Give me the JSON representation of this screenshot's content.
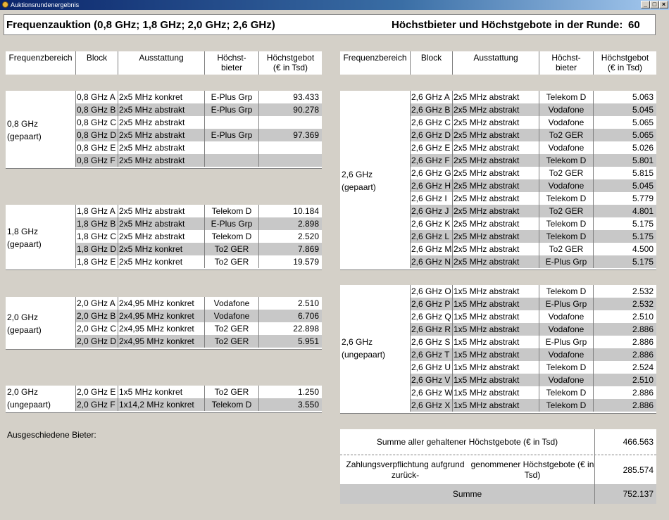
{
  "window": {
    "title": "Auktionsrundenergebnis",
    "buttons": {
      "minimize": "_",
      "restore": "□",
      "close": "×"
    }
  },
  "header": {
    "title": "Frequenzauktion (0,8 GHz; 1,8 GHz; 2,0 GHz; 2,6 GHz)",
    "round_label": "Höchstbieter und Höchstgebote in der Runde:",
    "round_number": "60"
  },
  "columns": {
    "range": "Frequenzbereich",
    "block": "Block",
    "ausstattung": "Ausstattung",
    "bidder_l1": "Höchst-",
    "bidder_l2": "bieter",
    "bid_l1": "Höchstgebot",
    "bid_l2": "(€ in Tsd)"
  },
  "groups": [
    {
      "range_l1": "0,8 GHz",
      "range_l2": "(gepaart)",
      "rows": [
        {
          "block": "0,8 GHz A",
          "ausstattung": "2x5 MHz konkret",
          "bidder": "E-Plus Grp",
          "bid": "93.433"
        },
        {
          "block": "0,8 GHz B",
          "ausstattung": "2x5 MHz abstrakt",
          "bidder": "E-Plus Grp",
          "bid": "90.278"
        },
        {
          "block": "0,8 GHz C",
          "ausstattung": "2x5 MHz abstrakt",
          "bidder": "",
          "bid": ""
        },
        {
          "block": "0,8 GHz D",
          "ausstattung": "2x5 MHz abstrakt",
          "bidder": "E-Plus Grp",
          "bid": "97.369"
        },
        {
          "block": "0,8 GHz E",
          "ausstattung": "2x5 MHz abstrakt",
          "bidder": "",
          "bid": ""
        },
        {
          "block": "0,8 GHz F",
          "ausstattung": "2x5 MHz abstrakt",
          "bidder": "",
          "bid": ""
        }
      ]
    },
    {
      "range_l1": "1,8 GHz",
      "range_l2": "(gepaart)",
      "rows": [
        {
          "block": "1,8 GHz A",
          "ausstattung": "2x5 MHz abstrakt",
          "bidder": "Telekom D",
          "bid": "10.184"
        },
        {
          "block": "1,8 GHz B",
          "ausstattung": "2x5 MHz abstrakt",
          "bidder": "E-Plus Grp",
          "bid": "2.898"
        },
        {
          "block": "1,8 GHz C",
          "ausstattung": "2x5 MHz abstrakt",
          "bidder": "Telekom D",
          "bid": "2.520"
        },
        {
          "block": "1,8 GHz D",
          "ausstattung": "2x5 MHz konkret",
          "bidder": "To2 GER",
          "bid": "7.869"
        },
        {
          "block": "1,8 GHz E",
          "ausstattung": "2x5 MHz konkret",
          "bidder": "To2 GER",
          "bid": "19.579"
        }
      ]
    },
    {
      "range_l1": "2,0 GHz",
      "range_l2": "(gepaart)",
      "rows": [
        {
          "block": "2,0 GHz A",
          "ausstattung": "2x4,95 MHz konkret",
          "bidder": "Vodafone",
          "bid": "2.510"
        },
        {
          "block": "2,0 GHz B",
          "ausstattung": "2x4,95 MHz konkret",
          "bidder": "Vodafone",
          "bid": "6.706"
        },
        {
          "block": "2,0 GHz C",
          "ausstattung": "2x4,95 MHz konkret",
          "bidder": "To2 GER",
          "bid": "22.898"
        },
        {
          "block": "2,0 GHz D",
          "ausstattung": "2x4,95 MHz konkret",
          "bidder": "To2 GER",
          "bid": "5.951"
        }
      ]
    },
    {
      "range_l1": "2,0 GHz",
      "range_l2": "(ungepaart)",
      "rows": [
        {
          "block": "2,0 GHz E",
          "ausstattung": "1x5 MHz konkret",
          "bidder": "To2 GER",
          "bid": "1.250"
        },
        {
          "block": "2,0 GHz F",
          "ausstattung": "1x14,2 MHz konkret",
          "bidder": "Telekom D",
          "bid": "3.550"
        }
      ]
    },
    {
      "range_l1": "2,6 GHz",
      "range_l2": "(gepaart)",
      "rows": [
        {
          "block": "2,6 GHz A",
          "ausstattung": "2x5 MHz abstrakt",
          "bidder": "Telekom D",
          "bid": "5.063"
        },
        {
          "block": "2,6 GHz B",
          "ausstattung": "2x5 MHz abstrakt",
          "bidder": "Vodafone",
          "bid": "5.045"
        },
        {
          "block": "2,6 GHz C",
          "ausstattung": "2x5 MHz abstrakt",
          "bidder": "Vodafone",
          "bid": "5.065"
        },
        {
          "block": "2,6 GHz D",
          "ausstattung": "2x5 MHz abstrakt",
          "bidder": "To2 GER",
          "bid": "5.065"
        },
        {
          "block": "2,6 GHz E",
          "ausstattung": "2x5 MHz abstrakt",
          "bidder": "Vodafone",
          "bid": "5.026"
        },
        {
          "block": "2,6 GHz F",
          "ausstattung": "2x5 MHz abstrakt",
          "bidder": "Telekom D",
          "bid": "5.801"
        },
        {
          "block": "2,6 GHz G",
          "ausstattung": "2x5 MHz abstrakt",
          "bidder": "To2 GER",
          "bid": "5.815"
        },
        {
          "block": "2,6 GHz H",
          "ausstattung": "2x5 MHz abstrakt",
          "bidder": "Vodafone",
          "bid": "5.045"
        },
        {
          "block": "2,6 GHz I",
          "ausstattung": "2x5 MHz abstrakt",
          "bidder": "Telekom D",
          "bid": "5.779"
        },
        {
          "block": "2,6 GHz J",
          "ausstattung": "2x5 MHz abstrakt",
          "bidder": "To2 GER",
          "bid": "4.801"
        },
        {
          "block": "2,6 GHz K",
          "ausstattung": "2x5 MHz abstrakt",
          "bidder": "Telekom D",
          "bid": "5.175"
        },
        {
          "block": "2,6 GHz L",
          "ausstattung": "2x5 MHz abstrakt",
          "bidder": "Telekom D",
          "bid": "5.175"
        },
        {
          "block": "2,6 GHz M",
          "ausstattung": "2x5 MHz abstrakt",
          "bidder": "To2 GER",
          "bid": "4.500"
        },
        {
          "block": "2,6 GHz N",
          "ausstattung": "2x5 MHz abstrakt",
          "bidder": "E-Plus Grp",
          "bid": "5.175"
        }
      ]
    },
    {
      "range_l1": "2,6 GHz",
      "range_l2": "(ungepaart)",
      "rows": [
        {
          "block": "2,6 GHz O",
          "ausstattung": "1x5 MHz abstrakt",
          "bidder": "Telekom D",
          "bid": "2.532"
        },
        {
          "block": "2,6 GHz P",
          "ausstattung": "1x5 MHz abstrakt",
          "bidder": "E-Plus Grp",
          "bid": "2.532"
        },
        {
          "block": "2,6 GHz Q",
          "ausstattung": "1x5 MHz abstrakt",
          "bidder": "Vodafone",
          "bid": "2.510"
        },
        {
          "block": "2,6 GHz R",
          "ausstattung": "1x5 MHz abstrakt",
          "bidder": "Vodafone",
          "bid": "2.886"
        },
        {
          "block": "2,6 GHz S",
          "ausstattung": "1x5 MHz abstrakt",
          "bidder": "E-Plus Grp",
          "bid": "2.886"
        },
        {
          "block": "2,6 GHz T",
          "ausstattung": "1x5 MHz abstrakt",
          "bidder": "Vodafone",
          "bid": "2.886"
        },
        {
          "block": "2,6 GHz U",
          "ausstattung": "1x5 MHz abstrakt",
          "bidder": "Telekom D",
          "bid": "2.524"
        },
        {
          "block": "2,6 GHz V",
          "ausstattung": "1x5 MHz abstrakt",
          "bidder": "Vodafone",
          "bid": "2.510"
        },
        {
          "block": "2,6 GHz W",
          "ausstattung": "1x5 MHz abstrakt",
          "bidder": "Telekom D",
          "bid": "2.886"
        },
        {
          "block": "2,6 GHz X",
          "ausstattung": "1x5 MHz abstrakt",
          "bidder": "Telekom D",
          "bid": "2.886"
        }
      ]
    }
  ],
  "ausgeschieden_label": "Ausgeschiedene Bieter:",
  "summary": {
    "held_label": "Summe aller gehaltener Höchstgebote (€ in Tsd)",
    "held_value": "466.563",
    "obligation_l1": "Zahlungsverpflichtung aufgrund zurück-",
    "obligation_l2": "genommener Höchstgebote (€ in Tsd)",
    "obligation_value": "285.574",
    "total_label": "Summe",
    "total_value": "752.137"
  }
}
